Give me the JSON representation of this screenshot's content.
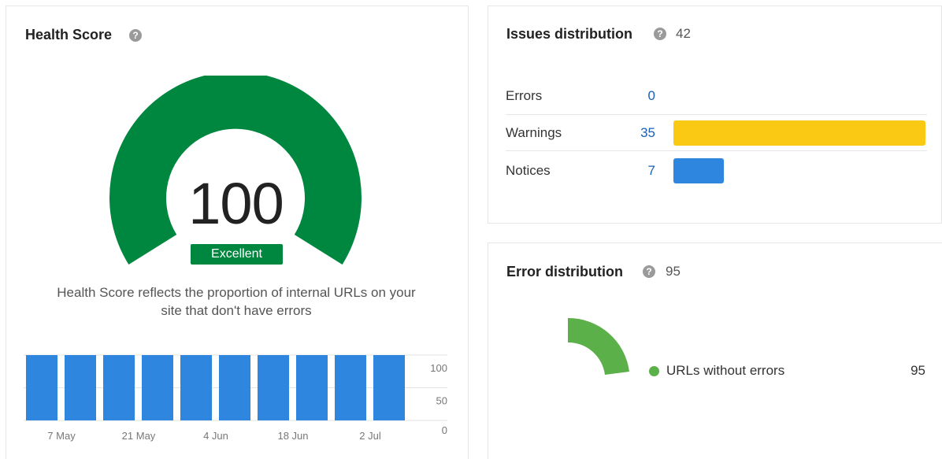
{
  "health": {
    "title": "Health Score",
    "help_icon": "?",
    "score": "100",
    "badge": "Excellent",
    "description_line1": "Health Score reflects the proportion of internal URLs on your",
    "description_line2": "site that don't have errors",
    "gauge_fill_fraction": 1.0,
    "gauge_color": "#00873f"
  },
  "issues": {
    "title": "Issues distribution",
    "help_icon": "?",
    "total": "42",
    "rows": [
      {
        "label": "Errors",
        "value": "0",
        "color": "#2e86de"
      },
      {
        "label": "Warnings",
        "value": "35",
        "color": "#f9c914"
      },
      {
        "label": "Notices",
        "value": "7",
        "color": "#2e86de"
      }
    ]
  },
  "errors": {
    "title": "Error distribution",
    "help_icon": "?",
    "total": "95",
    "legend_label": "URLs without errors",
    "legend_value": "95",
    "color": "#5cb04a"
  },
  "chart_data": {
    "type": "bar",
    "categories": [
      "",
      "7 May",
      "",
      "21 May",
      "",
      "4 Jun",
      "",
      "18 Jun",
      "",
      "2 Jul"
    ],
    "x_tick_labels": [
      "7 May",
      "21 May",
      "4 Jun",
      "18 Jun",
      "2 Jul"
    ],
    "values": [
      100,
      100,
      100,
      100,
      100,
      100,
      100,
      100,
      100,
      100
    ],
    "ylim": [
      0,
      100
    ],
    "yticks": [
      100,
      50,
      0
    ],
    "color": "#2e86de",
    "grid": true
  }
}
